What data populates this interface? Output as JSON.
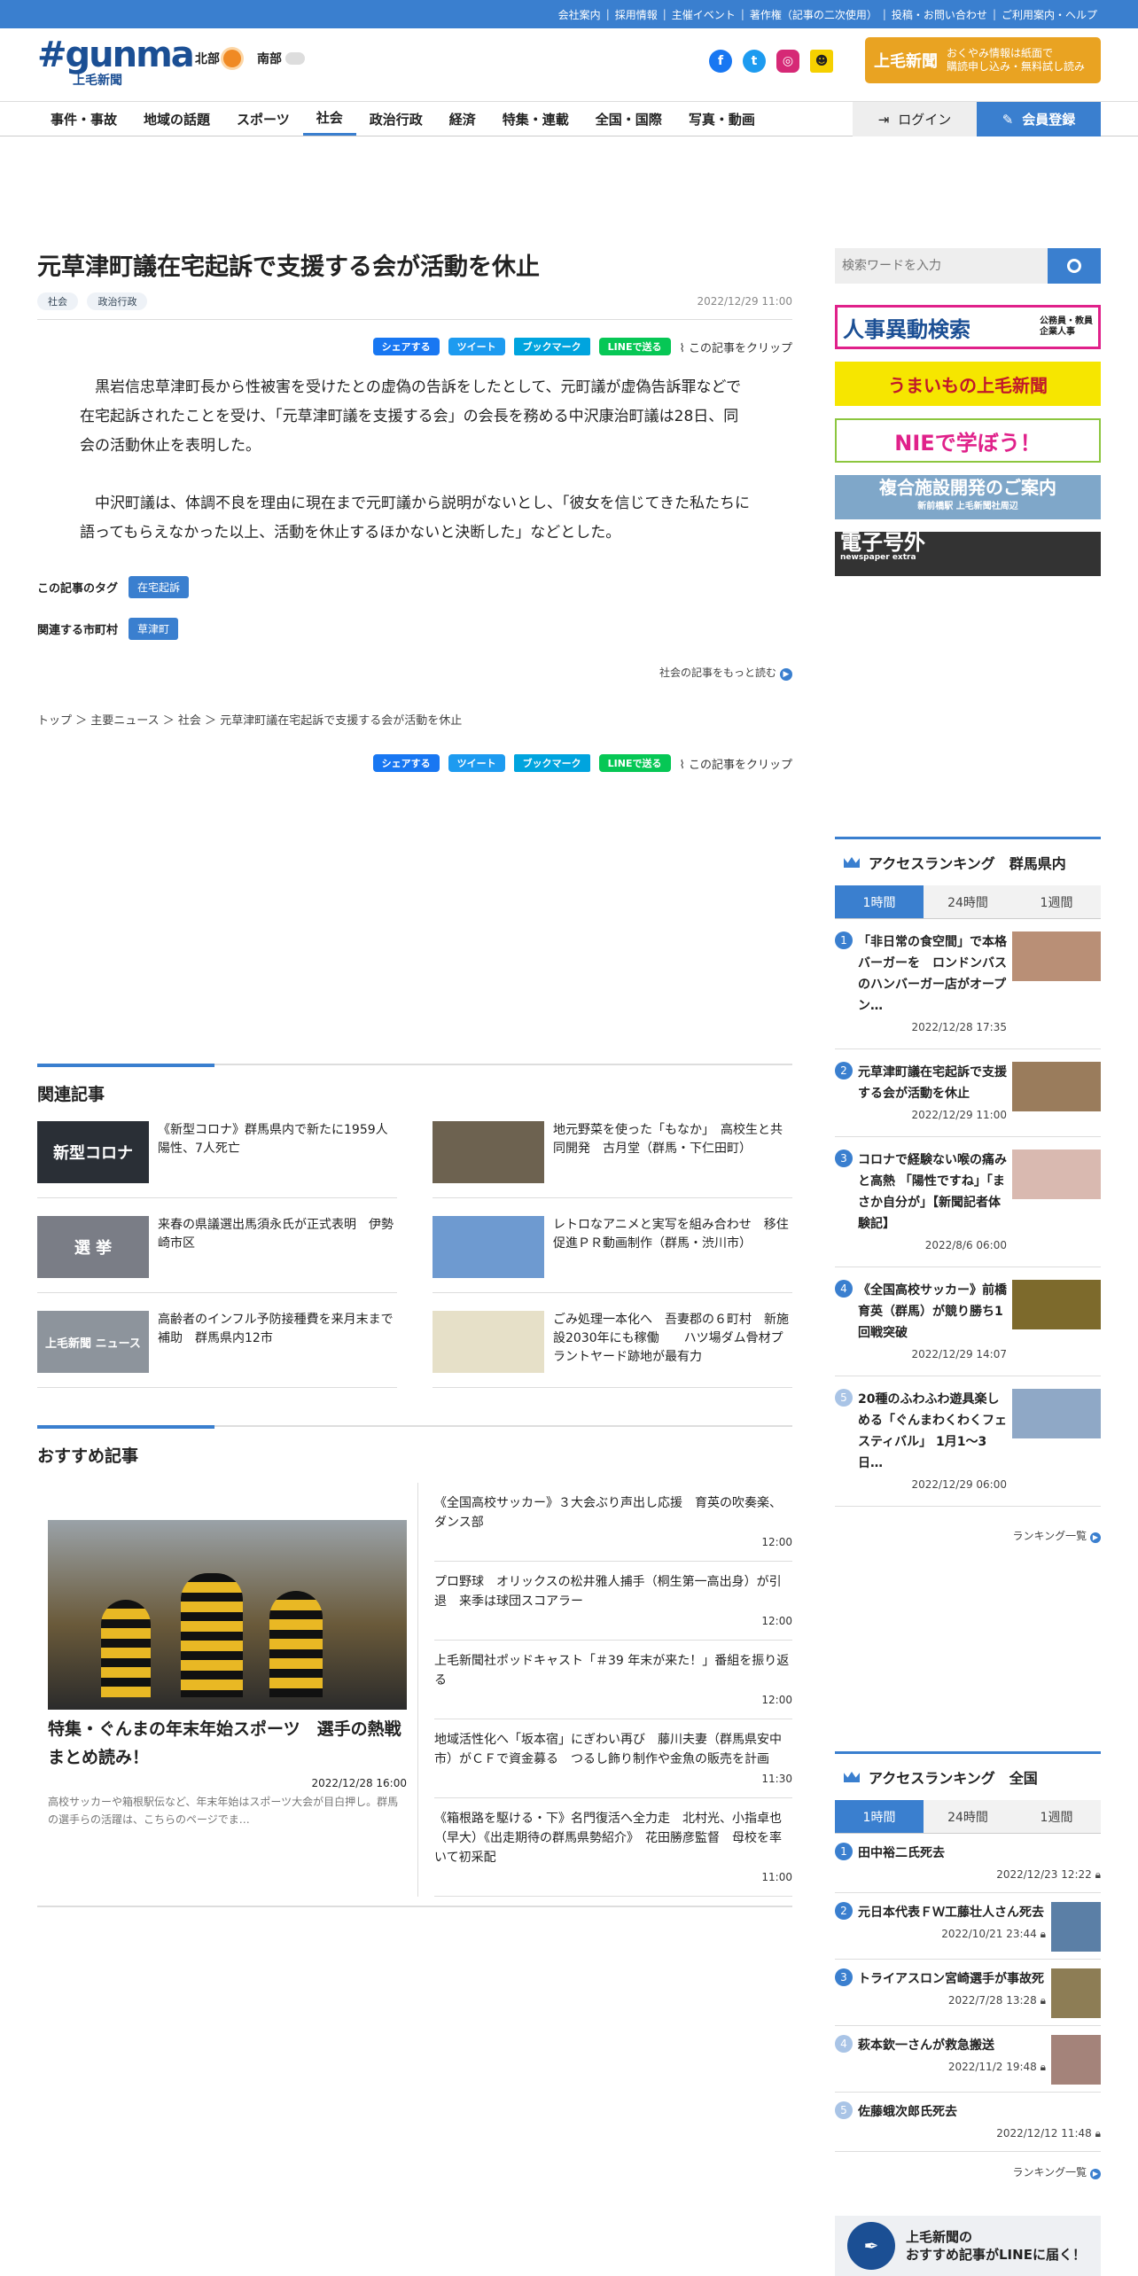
{
  "util_links": [
    "会社案内",
    "採用情報",
    "主催イベント",
    "著作権（記事の二次使用）",
    "投稿・お問い合わせ",
    "ご利用案内・ヘルプ"
  ],
  "logo": {
    "main": "#gunma",
    "sub": "上毛新聞"
  },
  "weather": [
    {
      "label": "北部",
      "icon": "sun-icon"
    },
    {
      "label": "南部",
      "icon": "partly-cloudy-icon"
    }
  ],
  "promo": {
    "name": "上毛新聞",
    "line1": "おくやみ情報は紙面で",
    "line2": "購読申し込み・無料試し読み"
  },
  "nav": [
    "事件・事故",
    "地域の話題",
    "スポーツ",
    "社会",
    "政治行政",
    "経済",
    "特集・連載",
    "全国・国際",
    "写真・動画"
  ],
  "nav_active": "社会",
  "login_label": "ログイン",
  "register_label": "会員登録",
  "article": {
    "title": "元草津町議在宅起訴で支援する会が活動を休止",
    "tags": [
      "社会",
      "政治行政"
    ],
    "date": "2022/12/29 11:00",
    "share": {
      "facebook": "シェアする",
      "twitter": "ツイート",
      "hatena": "ブックマーク",
      "line": "LINEで送る",
      "clip": "この記事をクリップ"
    },
    "paragraphs": [
      "黒岩信忠草津町長から性被害を受けたとの虚偽の告訴をしたとして、元町議が虚偽告訴罪などで在宅起訴されたことを受け、「元草津町議を支援する会」の会長を務める中沢康治町議は28日、同会の活動休止を表明した。",
      "中沢町議は、体調不良を理由に現在まで元町議から説明がないとし、「彼女を信じてきた私たちに語ってもらえなかった以上、活動を休止するほかないと決断した」などとした。"
    ],
    "tag_label": "この記事のタグ",
    "tag_value": "在宅起訴",
    "city_label": "関連する市町村",
    "city_value": "草津町",
    "more": "社会の記事をもっと読む",
    "breadcrumb": [
      "トップ",
      "主要ニュース",
      "社会",
      "元草津町議在宅起訴で支援する会が活動を休止"
    ]
  },
  "related": {
    "title": "関連記事",
    "items": [
      {
        "text": "《新型コロナ》群馬県内で新たに1959人陽性、7人死亡",
        "thumb": "新型コロナ",
        "color": "#2a2f36"
      },
      {
        "text": "地元野菜を使った「もなか」　高校生と共同開発　古月堂（群馬・下仁田町）",
        "thumb": "",
        "color": "#6d6250"
      },
      {
        "text": "来春の県議選出馬須永氏が正式表明　伊勢崎市区",
        "thumb": "選 挙",
        "color": "#7a7d86"
      },
      {
        "text": "レトロなアニメと実写を組み合わせ　移住促進ＰＲ動画制作（群馬・渋川市）",
        "thumb": "",
        "color": "#6e9ad0"
      },
      {
        "text": "高齢者のインフル予防接種費を来月末まで補助　群馬県内12市",
        "thumb": "上毛新聞 ニュース",
        "color": "#8d949c"
      },
      {
        "text": "ごみ処理一本化へ　吾妻郡の６町村　新施設2030年にも稼働　　ハツ場ダム骨材プラントヤード跡地が最有力",
        "thumb": "",
        "color": "#e6e0c8"
      }
    ]
  },
  "recommend": {
    "title": "おすすめ記事",
    "feature": {
      "title": "特集・ぐんまの年末年始スポーツ　選手の熱戦まとめ読み！",
      "date": "2022/12/28 16:00",
      "desc": "高校サッカーや箱根駅伝など、年末年始はスポーツ大会が目白押し。群馬の選手らの活躍は、こちらのページでま…"
    },
    "list": [
      {
        "text": "《全国高校サッカー》３大会ぶり声出し応援　育英の吹奏楽、ダンス部",
        "time": "12:00"
      },
      {
        "text": "プロ野球　オリックスの松井雅人捕手（桐生第一高出身）が引退　来季は球団スコアラー",
        "time": "12:00"
      },
      {
        "text": "上毛新聞社ポッドキャスト「＃39 年末が来た！」番組を振り返る",
        "time": "12:00"
      },
      {
        "text": "地域活性化へ「坂本宿」にぎわい再び　藤川夫妻（群馬県安中市）がＣＦで資金募る　つるし飾り制作や金魚の販売を計画",
        "time": "11:30"
      },
      {
        "text": "《箱根路を駆ける・下》名門復活へ全力走　北村光、小指卓也（早大）《出走期待の群馬県勢紹介》　花田勝彦監督　母校を率いて初采配",
        "time": "11:00"
      }
    ]
  },
  "search": {
    "placeholder": "検索ワードを入力"
  },
  "banners": [
    "人事異動検索",
    "うまいもの上毛新聞",
    "NIEで学ぼう！",
    "複合施設開発のご案内",
    "電子号外"
  ],
  "banner_subs": [
    "公務員・教員 企業人事",
    "",
    "",
    "新前橋駅 上毛新聞社周辺",
    "newspaper extra"
  ],
  "rank_local": {
    "title": "アクセスランキング　群馬県内",
    "tabs": [
      "1時間",
      "24時間",
      "1週間"
    ],
    "items": [
      {
        "n": "1",
        "text": "「非日常の食空間」で本格バーガーを　ロンドンバスのハンバーガー店がオープン…",
        "date": "2022/12/28 17:35",
        "color": "#b98f76"
      },
      {
        "n": "2",
        "text": "元草津町議在宅起訴で支援する会が活動を休止",
        "date": "2022/12/29 11:00",
        "color": "#9a7c5c"
      },
      {
        "n": "3",
        "text": "コロナで経験ない喉の痛みと高熱 「陽性ですね」「まさか自分が」【新聞記者体験記】",
        "date": "2022/8/6 06:00",
        "color": "#d9b9b0"
      },
      {
        "n": "4",
        "text": "《全国高校サッカー》前橋育英（群馬）が競り勝ち1回戦突破",
        "date": "2022/12/29 14:07",
        "color": "#7d6a2c"
      },
      {
        "n": "5",
        "text": "20種のふわふわ遊具楽しめる「ぐんまわくわくフェスティバル」 1月1～3日…",
        "date": "2022/12/29 06:00",
        "color": "#8fa8c6"
      }
    ],
    "more": "ランキング一覧"
  },
  "rank_national": {
    "title": "アクセスランキング　全国",
    "tabs": [
      "1時間",
      "24時間",
      "1週間"
    ],
    "items": [
      {
        "n": "1",
        "text": "田中裕二氏死去",
        "date": "2022/12/23 12:22",
        "pic": false
      },
      {
        "n": "2",
        "text": "元日本代表ＦＷ工藤壮人さん死去",
        "date": "2022/10/21 23:44",
        "pic": true
      },
      {
        "n": "3",
        "text": "トライアスロン宮崎選手が事故死",
        "date": "2022/7/28 13:28",
        "pic": true
      },
      {
        "n": "4",
        "text": "萩本欽一さんが救急搬送",
        "date": "2022/11/2 19:48",
        "pic": true
      },
      {
        "n": "5",
        "text": "佐藤蛾次郎氏死去",
        "date": "2022/12/12 11:48",
        "pic": false
      }
    ],
    "more": "ランキング一覧"
  },
  "line_promo": {
    "line1": "上毛新聞の",
    "line2": "おすすめ記事がLINEに届く！"
  }
}
